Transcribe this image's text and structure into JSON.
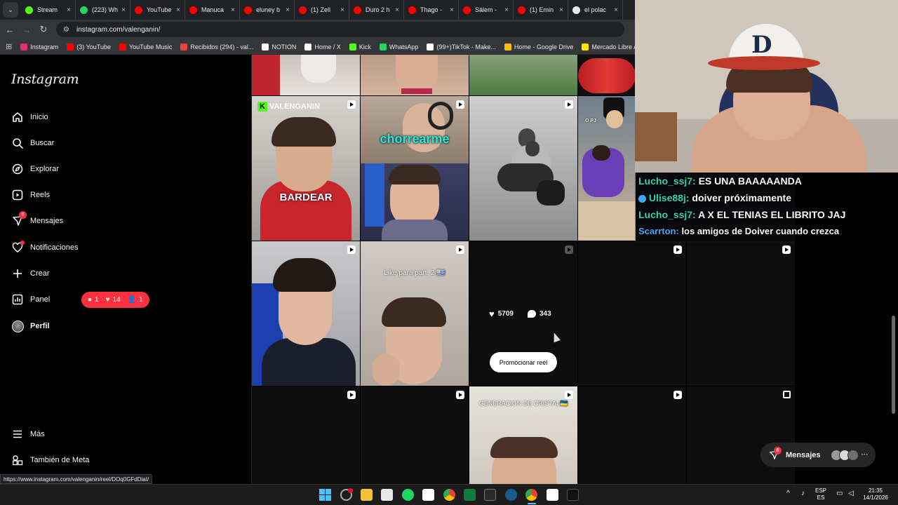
{
  "browser": {
    "tabs": [
      {
        "title": "Stream",
        "color": "#53fc18"
      },
      {
        "title": "(223) Wh",
        "color": "#25d366"
      },
      {
        "title": "YouTube",
        "color": "#ff0000"
      },
      {
        "title": "Manuca",
        "color": "#ff0000"
      },
      {
        "title": "eluney b",
        "color": "#ff0000"
      },
      {
        "title": "(1) Zell",
        "color": "#ff0000"
      },
      {
        "title": "Duro 2 h",
        "color": "#ff0000"
      },
      {
        "title": "Thago -",
        "color": "#ff0000"
      },
      {
        "title": "Sálem -",
        "color": "#ff0000"
      },
      {
        "title": "(1) Emin",
        "color": "#ff0000"
      },
      {
        "title": "el polac",
        "color": "#e8eaed"
      }
    ],
    "url": "instagram.com/valenganin/",
    "bookmarks": [
      {
        "label": "Instagram",
        "color": "#e1306c"
      },
      {
        "label": "(3) YouTube",
        "color": "#ff0000"
      },
      {
        "label": "YouTube Music",
        "color": "#ff0000"
      },
      {
        "label": "Recibidos (294) - val...",
        "color": "#ea4335"
      },
      {
        "label": "NOTION",
        "color": "#ffffff"
      },
      {
        "label": "Home / X",
        "color": "#ffffff"
      },
      {
        "label": "Kick",
        "color": "#53fc18"
      },
      {
        "label": "WhatsApp",
        "color": "#25d366"
      },
      {
        "label": "(99+)TikTok - Make...",
        "color": "#ffffff"
      },
      {
        "label": "Home - Google Drive",
        "color": "#fbbc04"
      },
      {
        "label": "Mercado Libre Arge...",
        "color": "#ffe600"
      },
      {
        "label": "PRO",
        "color": "#bdc1c6"
      }
    ],
    "status_url": "https://www.instagram.com/valenganin/reel/DOq0GFdDiaI/"
  },
  "instagram": {
    "logo": "Instagram",
    "nav": {
      "inicio": "Inicio",
      "buscar": "Buscar",
      "explorar": "Explorar",
      "reels": "Reels",
      "mensajes": "Mensajes",
      "mensajes_badge": "6",
      "notificaciones": "Notificaciones",
      "crear": "Crear",
      "panel": "Panel",
      "perfil": "Perfil",
      "mas": "Más",
      "meta": "También de Meta"
    },
    "notif_pill": {
      "comments": "1",
      "likes": "14",
      "follows": "1"
    },
    "grid": {
      "bardear_tag": "VALENGANIN",
      "bardear_text": "BARDEAR",
      "chorrearme_text": "chorrearme",
      "goku_tag": "O PJ",
      "likepart_text": "Like para part. 2 🇺🇾",
      "hover_likes": "5709",
      "hover_comments": "343",
      "promote_label": "Promocionar reel",
      "generacion_text": "GENERACION DE CRISTAL🇺🇦"
    },
    "messages_fab": {
      "label": "Mensajes",
      "badge": "6"
    }
  },
  "chat": [
    {
      "user": "Lucho_ssj7",
      "user_color": "#2fd4b0",
      "text": "ES UNA BAAAAANDA"
    },
    {
      "user": "Ulise88j",
      "user_color": "#2fd4b0",
      "text": "doiver próximamente"
    },
    {
      "user": "Lucho_ssj7",
      "user_color": "#2fd4b0",
      "text": "A X EL TENIAS EL LIBRITO JAJ"
    },
    {
      "user": "Scarrton",
      "user_color": "#3fa9f5",
      "text": "los amigos de Doiver cuando crezca"
    }
  ],
  "taskbar": {
    "lang_top": "ESP",
    "lang_bottom": "ES",
    "time": "21:35",
    "date": "14/1/2026"
  }
}
